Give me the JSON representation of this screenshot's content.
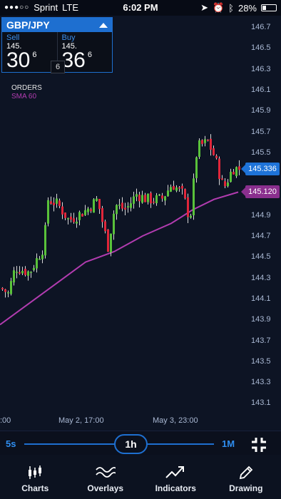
{
  "status_bar": {
    "carrier": "Sprint",
    "network": "LTE",
    "time": "6:02 PM",
    "battery": "28%"
  },
  "ticker": {
    "symbol": "GBP/JPY",
    "sell": {
      "label": "Sell",
      "big": "145.",
      "num": "30",
      "sup": "6"
    },
    "buy": {
      "label": "Buy",
      "big": "145.",
      "num": "36",
      "sup": "6"
    },
    "spread": "6"
  },
  "legend": {
    "orders": "ORDERS",
    "sma": "SMA 60"
  },
  "price_tags": {
    "last": "145.336",
    "sma": "145.120"
  },
  "colors": {
    "up": "#59c23a",
    "down": "#e0263a",
    "sma": "#b23cb0",
    "accent": "#1e73d8"
  },
  "chart_data": {
    "type": "candlestick",
    "y_axis": [
      "146.7",
      "146.5",
      "146.3",
      "146.1",
      "145.9",
      "145.7",
      "145.5",
      "145.3",
      "145.1",
      "144.9",
      "144.7",
      "144.5",
      "144.3",
      "144.1",
      "143.9",
      "143.7",
      "143.5",
      "143.3",
      "143.1"
    ],
    "x_axis": [
      ":00",
      "May 2, 17:00",
      "May 3, 23:00"
    ],
    "ylim": [
      143.0,
      146.8
    ],
    "last_price": 145.336,
    "sma_label": "SMA 60",
    "sma_last": 145.12,
    "grid": false
  },
  "timeframe": {
    "min": "5s",
    "current": "1h",
    "max": "1M"
  },
  "tabs": [
    {
      "label": "Charts",
      "icon": "candlestick-icon"
    },
    {
      "label": "Overlays",
      "icon": "wave-icon"
    },
    {
      "label": "Indicators",
      "icon": "trend-icon"
    },
    {
      "label": "Drawing",
      "icon": "pencil-icon"
    }
  ]
}
